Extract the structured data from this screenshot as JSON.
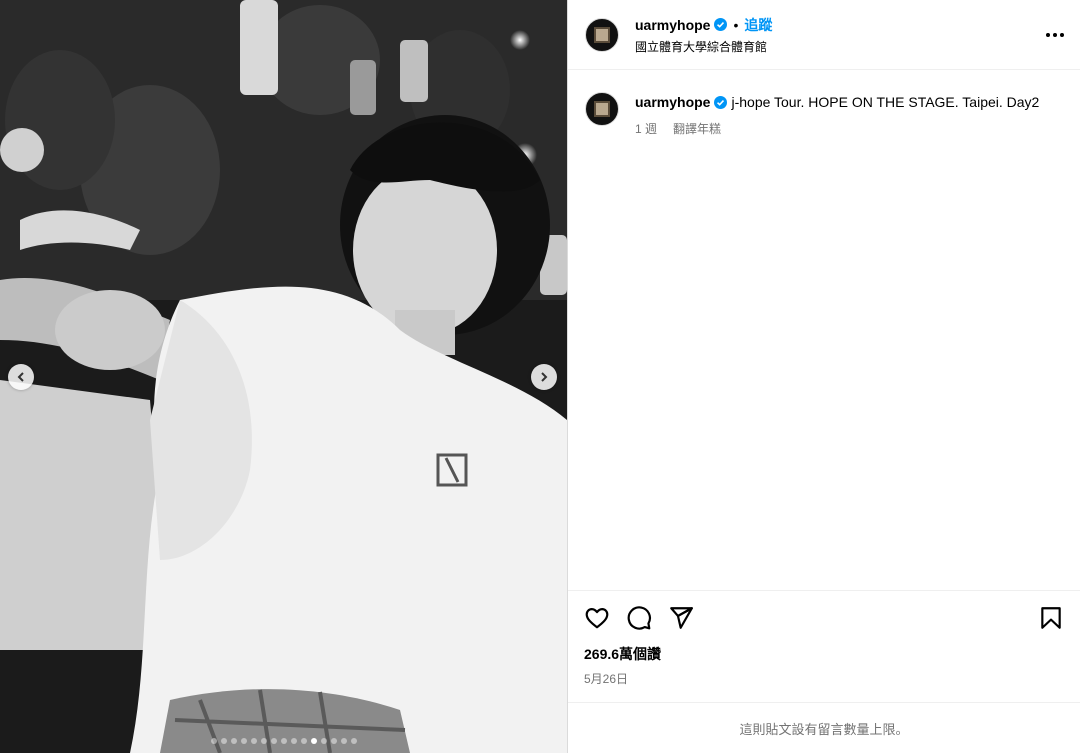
{
  "post": {
    "username": "uarmyhope",
    "follow_label": "追蹤",
    "separator": "•",
    "location": "國立體育大學綜合體育館",
    "caption": "j-hope Tour. HOPE ON THE STAGE. Taipei. Day2",
    "age": "1 週",
    "translate_label": "翻譯年糕",
    "likes": "269.6萬個讚",
    "date": "5月26日",
    "comment_limit_notice": "這則貼文設有留言數量上限。"
  },
  "carousel": {
    "total_dots": 15,
    "active_index": 10
  },
  "icons": {
    "verified": "verified-badge-icon",
    "more": "more-options-icon",
    "like": "heart-icon",
    "comment": "comment-icon",
    "share": "send-icon",
    "save": "bookmark-icon",
    "prev": "chevron-left-icon",
    "next": "chevron-right-icon"
  },
  "colors": {
    "accent": "#0095f6",
    "muted": "#737373",
    "border": "#dbdbdb"
  }
}
